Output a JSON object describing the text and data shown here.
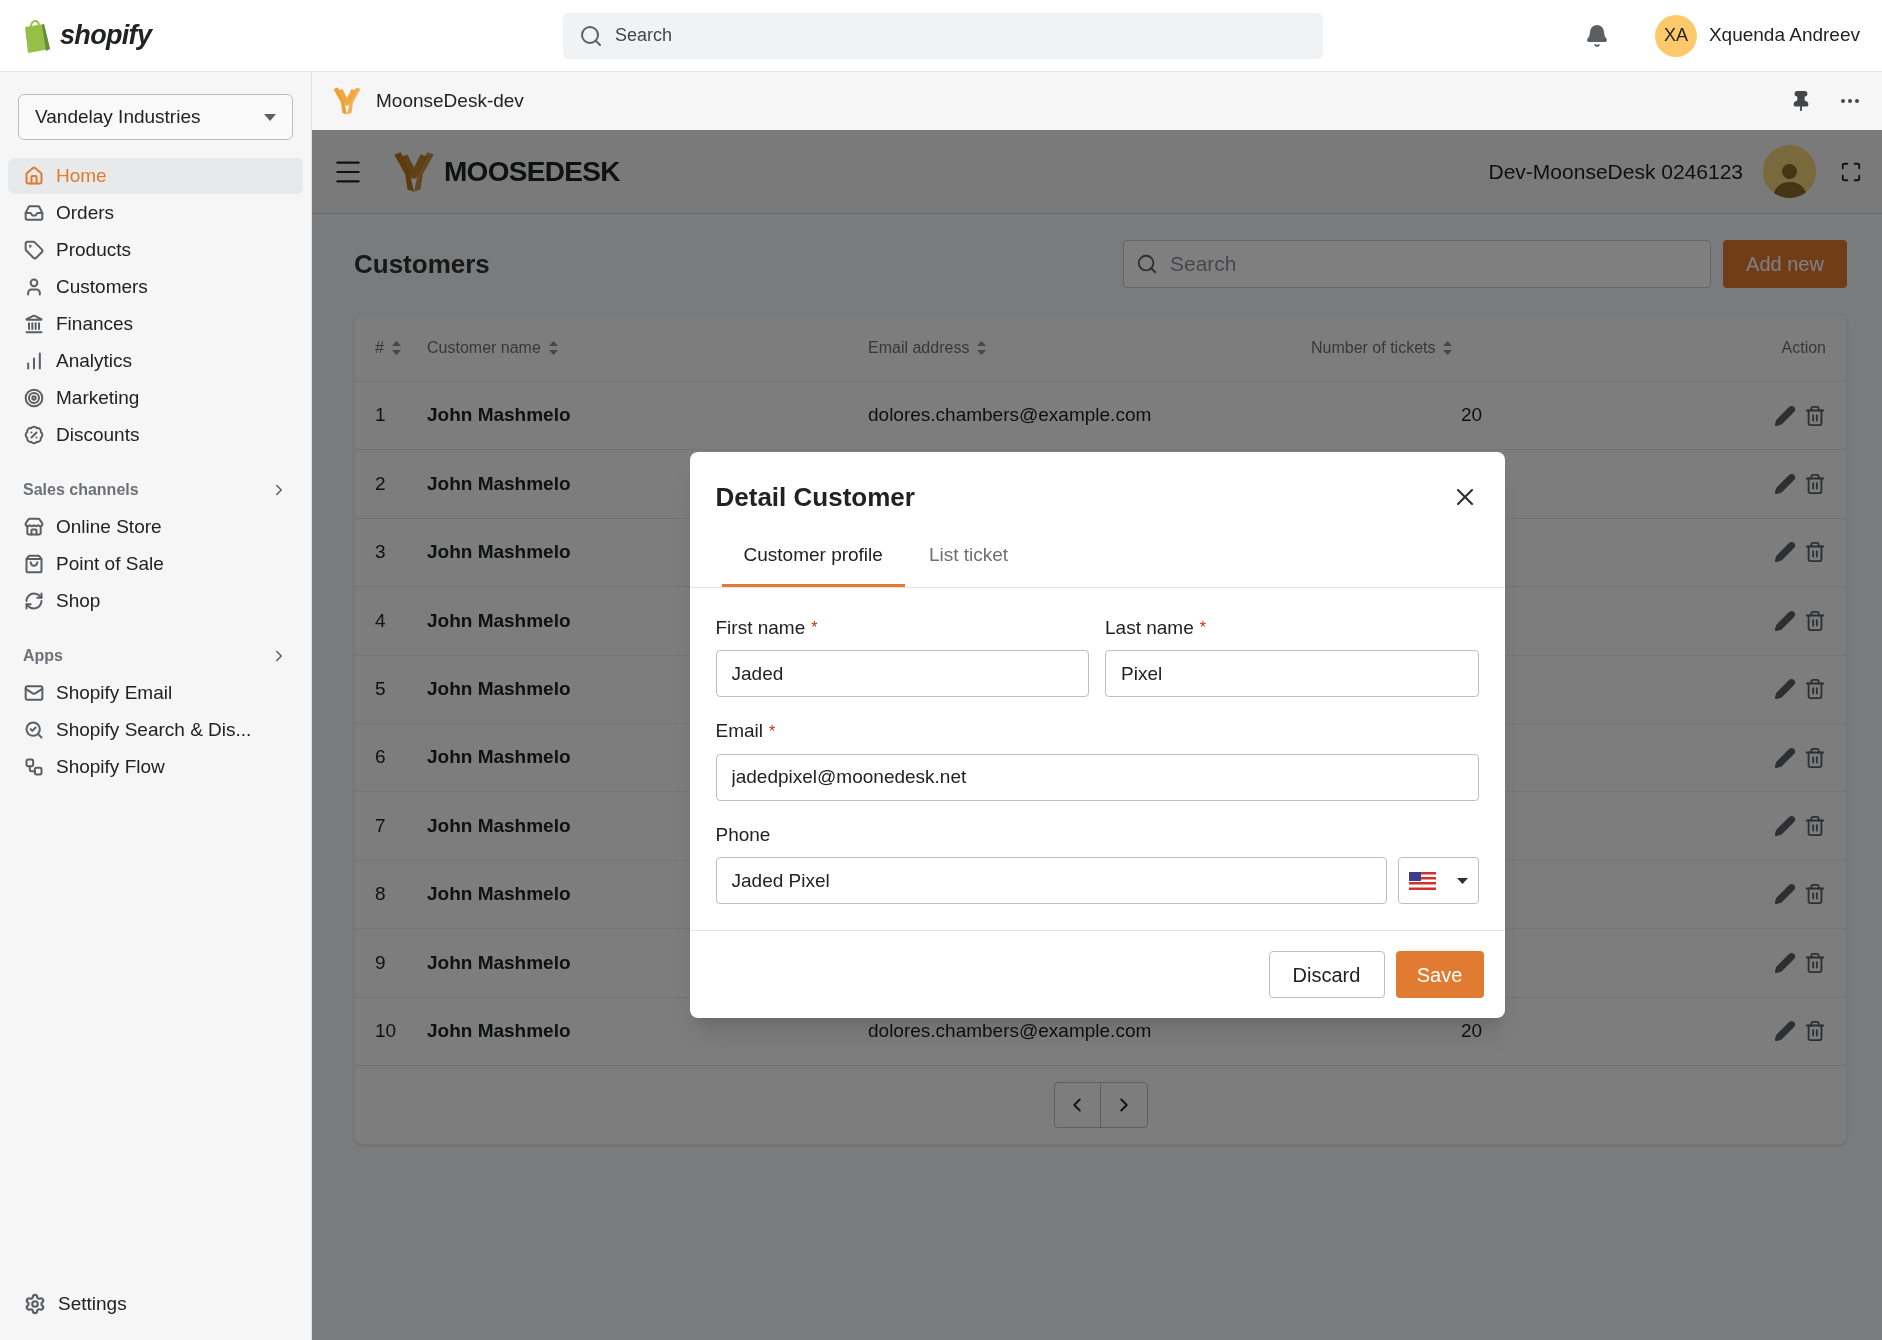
{
  "topbar": {
    "brand": "shopify",
    "search": {
      "placeholder": "Search"
    },
    "user": {
      "initials": "XA",
      "name": "Xquenda Andreev"
    }
  },
  "sidebar": {
    "store": "Vandelay Industries",
    "items": [
      {
        "label": "Home",
        "selected": true
      },
      {
        "label": "Orders",
        "selected": false
      },
      {
        "label": "Products",
        "selected": false
      },
      {
        "label": "Customers",
        "selected": false
      },
      {
        "label": "Finances",
        "selected": false
      },
      {
        "label": "Analytics",
        "selected": false
      },
      {
        "label": "Marketing",
        "selected": false
      },
      {
        "label": "Discounts",
        "selected": false
      }
    ],
    "sections": [
      {
        "title": "Sales channels",
        "items": [
          {
            "label": "Online Store",
            "selected": false
          },
          {
            "label": "Point of Sale",
            "selected": false
          },
          {
            "label": "Shop",
            "selected": false
          }
        ]
      },
      {
        "title": "Apps",
        "items": [
          {
            "label": "Shopify Email",
            "selected": false
          },
          {
            "label": "Shopify Search & Dis...",
            "selected": false
          },
          {
            "label": "Shopify Flow",
            "selected": false
          }
        ]
      }
    ],
    "settings": "Settings"
  },
  "app_bar": {
    "title": "MoonseDesk-dev"
  },
  "app_header": {
    "logo_text": "MOOSEDESK",
    "account": "Dev-MoonseDesk 0246123"
  },
  "page": {
    "title": "Customers",
    "search": {
      "placeholder": "Search"
    },
    "add_button": "Add new"
  },
  "table": {
    "columns": [
      "#",
      "Customer name",
      "Email address",
      "Number of tickets",
      "Action"
    ],
    "rows": [
      {
        "index": "1",
        "name": "John Mashmelo",
        "email": "dolores.chambers@example.com",
        "tickets": "20"
      },
      {
        "index": "2",
        "name": "John Mashmelo"
      },
      {
        "index": "3",
        "name": "John Mashmelo"
      },
      {
        "index": "4",
        "name": "John Mashmelo"
      },
      {
        "index": "5",
        "name": "John Mashmelo"
      },
      {
        "index": "6",
        "name": "John Mashmelo"
      },
      {
        "index": "7",
        "name": "John Mashmelo"
      },
      {
        "index": "8",
        "name": "John Mashmelo"
      },
      {
        "index": "9",
        "name": "John Mashmelo"
      },
      {
        "index": "10",
        "name": "John Mashmelo",
        "email": "dolores.chambers@example.com",
        "tickets": "20"
      }
    ]
  },
  "modal": {
    "title": "Detail Customer",
    "tabs": [
      {
        "label": "Customer profile",
        "selected": true
      },
      {
        "label": "List ticket",
        "selected": false
      }
    ],
    "fields": [
      {
        "kind": "half",
        "label": "First name",
        "required_mark": "*",
        "value": "Jaded"
      },
      {
        "kind": "half",
        "label": "Last name",
        "required_mark": "*",
        "value": "Pixel"
      },
      {
        "kind": "full",
        "label": "Email",
        "required_mark": "*",
        "value": "jadedpixel@moonedesk.net"
      },
      {
        "kind": "phone",
        "label": "Phone",
        "value": "Jaded Pixel"
      }
    ],
    "discard": "Discard",
    "save": "Save"
  }
}
